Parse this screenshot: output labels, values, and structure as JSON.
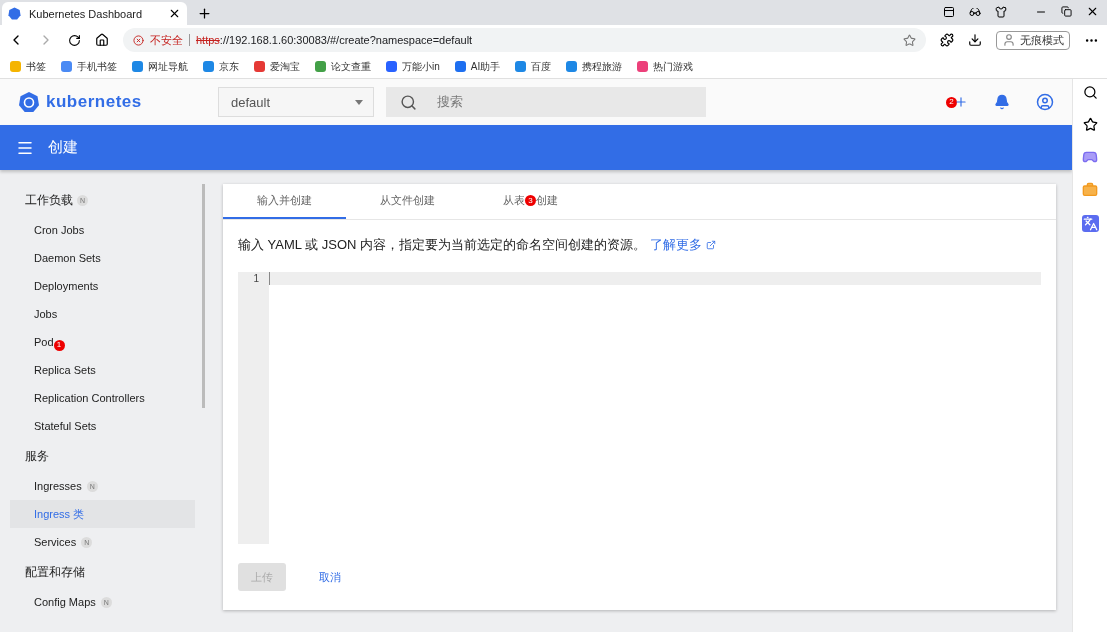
{
  "browser": {
    "tab_title": "Kubernetes Dashboard",
    "insecure_label": "不安全",
    "url_scheme": "https",
    "url_rest": "://192.168.1.60:30083/#/create?namespace=default",
    "profile": "无痕模式",
    "bookmarks": [
      {
        "label": "书签",
        "color": "#f5b400"
      },
      {
        "label": "手机书签",
        "color": "#4a8af4"
      },
      {
        "label": "网址导航",
        "color": "#1e88e5"
      },
      {
        "label": "京东",
        "color": "#1e88e5"
      },
      {
        "label": "爱淘宝",
        "color": "#e53935"
      },
      {
        "label": "论文查重",
        "color": "#43a047"
      },
      {
        "label": "万能小in",
        "color": "#2962ff"
      },
      {
        "label": "AI助手",
        "color": "#1e6ff0"
      },
      {
        "label": "百度",
        "color": "#1e88e5"
      },
      {
        "label": "携程旅游",
        "color": "#1e88e5"
      },
      {
        "label": "热门游戏",
        "color": "#ec407a"
      }
    ]
  },
  "app": {
    "brand": "kubernetes",
    "namespace": "default",
    "search_placeholder": "搜索",
    "create_annotation": "2",
    "toolbar_title": "创建",
    "sidebar": [
      {
        "title": "工作负载",
        "badge": "N",
        "items": [
          {
            "label": "Cron Jobs",
            "selected": false
          },
          {
            "label": "Daemon Sets",
            "selected": false
          },
          {
            "label": "Deployments",
            "selected": false
          },
          {
            "label": "Jobs",
            "selected": false
          },
          {
            "label": "Pod",
            "annotation": "1",
            "selected": false
          },
          {
            "label": "Replica Sets",
            "selected": false
          },
          {
            "label": "Replication Controllers",
            "selected": false
          },
          {
            "label": "Stateful Sets",
            "selected": false
          }
        ]
      },
      {
        "title": "服务",
        "items": [
          {
            "label": "Ingresses",
            "badge": "N",
            "selected": false
          },
          {
            "label": "Ingress 类",
            "selected": true
          },
          {
            "label": "Services",
            "badge": "N",
            "selected": false
          }
        ]
      },
      {
        "title": "配置和存储",
        "items": [
          {
            "label": "Config Maps",
            "badge": "N",
            "selected": false
          }
        ]
      }
    ],
    "tabs": [
      {
        "label": "输入并创建",
        "selected": true
      },
      {
        "label": "从文件创建",
        "selected": false
      },
      {
        "label": "从表",
        "annotation": "3",
        "label_rest": "创建",
        "selected": false
      }
    ],
    "description": "输入 YAML 或 JSON 内容，指定要为当前选定的命名空间创建的资源。",
    "learn_more": "了解更多",
    "editor": {
      "line_numbers": [
        "1"
      ]
    },
    "buttons": [
      {
        "label": "上传",
        "kind": "raised",
        "disabled": true
      },
      {
        "label": "取消",
        "kind": "flat",
        "disabled": false
      }
    ]
  }
}
